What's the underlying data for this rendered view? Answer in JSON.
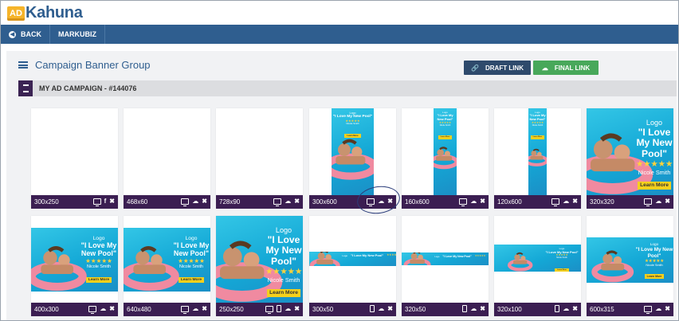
{
  "app": {
    "logo_badge": "AD",
    "logo_word": "Kahuna",
    "brand_color": "#2f5e8f",
    "accent_color": "#f6b42a"
  },
  "nav": {
    "back": "BACK",
    "markubiz": "MARKUBIZ"
  },
  "page": {
    "title": "Campaign Banner Group",
    "draft_link": "DRAFT LINK",
    "final_link": "FINAL LINK"
  },
  "group": {
    "title": "MY AD CAMPAIGN - #144076"
  },
  "banners": [
    {
      "size": "300x250",
      "icons": [
        "monitor-icon",
        "facebook-icon",
        "close-icon"
      ],
      "preview": "blank"
    },
    {
      "size": "468x60",
      "icons": [
        "monitor-icon",
        "cloud-download-icon",
        "close-icon"
      ],
      "preview": "blank"
    },
    {
      "size": "728x90",
      "icons": [
        "monitor-icon",
        "cloud-download-icon",
        "close-icon"
      ],
      "preview": "blank"
    },
    {
      "size": "300x600",
      "icons": [
        "monitor-icon",
        "cloud-download-icon",
        "close-icon"
      ],
      "preview": "pool-ad"
    },
    {
      "size": "160x600",
      "icons": [
        "monitor-icon",
        "cloud-download-icon",
        "close-icon"
      ],
      "preview": "pool-ad"
    },
    {
      "size": "120x600",
      "icons": [
        "monitor-icon",
        "cloud-download-icon",
        "close-icon"
      ],
      "preview": "pool-ad"
    },
    {
      "size": "320x320",
      "icons": [
        "monitor-icon",
        "cloud-download-icon",
        "close-icon"
      ],
      "preview": "pool-ad"
    },
    {
      "size": "400x300",
      "icons": [
        "monitor-icon",
        "cloud-download-icon",
        "close-icon"
      ],
      "preview": "pool-ad"
    },
    {
      "size": "640x480",
      "icons": [
        "monitor-icon",
        "cloud-download-icon",
        "close-icon"
      ],
      "preview": "pool-ad"
    },
    {
      "size": "250x250",
      "icons": [
        "monitor-icon",
        "phone-icon",
        "cloud-download-icon",
        "close-icon"
      ],
      "preview": "pool-ad"
    },
    {
      "size": "300x50",
      "icons": [
        "phone-icon",
        "cloud-download-icon",
        "close-icon"
      ],
      "preview": "pool-ad"
    },
    {
      "size": "320x50",
      "icons": [
        "phone-icon",
        "cloud-download-icon",
        "close-icon"
      ],
      "preview": "pool-ad"
    },
    {
      "size": "320x100",
      "icons": [
        "phone-icon",
        "cloud-download-icon",
        "close-icon"
      ],
      "preview": "pool-ad"
    },
    {
      "size": "600x315",
      "icons": [
        "monitor-icon",
        "cloud-download-icon",
        "close-icon"
      ],
      "preview": "pool-ad"
    }
  ],
  "ad_creative": {
    "logo": "Logo",
    "headline": "\"I Love My New Pool\"",
    "stars": "★★★★★",
    "attribution": "Nicole Smith",
    "cta": "Learn More"
  }
}
